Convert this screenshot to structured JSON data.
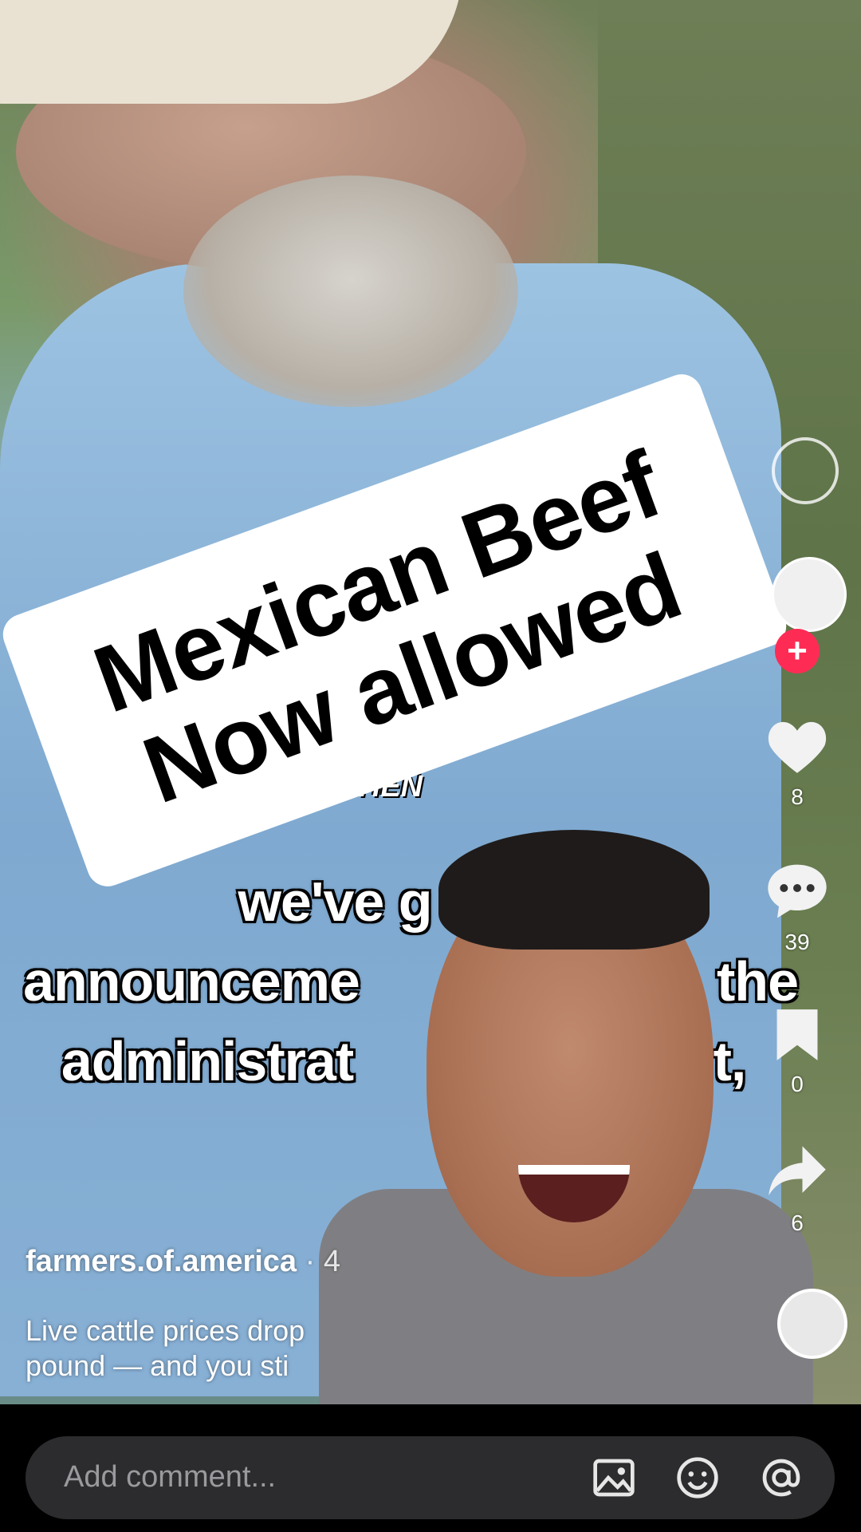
{
  "overlay": {
    "banner_line1": "Mexican Beef",
    "banner_line2": "Now allowed"
  },
  "captions": {
    "small": "OPLE WHEN",
    "line1": "we've g",
    "line2_left": "announceme",
    "line2_right": "the",
    "line3_left": "administrat",
    "line3_right": "t,"
  },
  "actions": {
    "likes": "8",
    "comments": "39",
    "saves": "0",
    "shares": "6"
  },
  "post": {
    "author": "farmers.of.america",
    "meta": "· 4",
    "desc_line1": "Live cattle prices drop",
    "desc_line2": "pound — and you sti"
  },
  "comment_bar": {
    "placeholder": "Add comment..."
  },
  "colors": {
    "accent": "#fe2c55",
    "comment_bar": "#2c2c2e"
  },
  "icons": [
    "search-icon",
    "plus-icon",
    "heart-icon",
    "comment-icon",
    "bookmark-icon",
    "share-icon",
    "image-icon",
    "emoji-icon",
    "mention-icon"
  ]
}
